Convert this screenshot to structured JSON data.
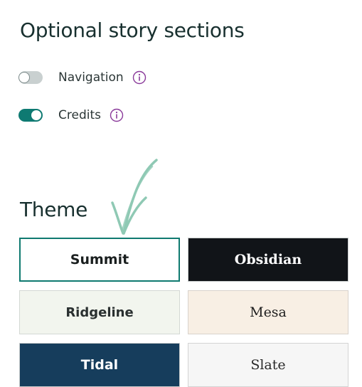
{
  "optional_sections": {
    "title": "Optional story sections",
    "toggles": [
      {
        "label": "Navigation",
        "enabled": false,
        "info_icon": "info-icon"
      },
      {
        "label": "Credits",
        "enabled": true,
        "info_icon": "info-icon"
      }
    ]
  },
  "theme": {
    "title": "Theme",
    "selected": "Summit",
    "options": [
      {
        "label": "Summit",
        "background": "#ffffff",
        "text_color": "#1a1f1f"
      },
      {
        "label": "Obsidian",
        "background": "#111418",
        "text_color": "#ffffff"
      },
      {
        "label": "Ridgeline",
        "background": "#f2f5ee",
        "text_color": "#2a3030"
      },
      {
        "label": "Mesa",
        "background": "#f8efe4",
        "text_color": "#1e1e1e"
      },
      {
        "label": "Tidal",
        "background": "#163d5c",
        "text_color": "#ffffff"
      },
      {
        "label": "Slate",
        "background": "#f6f6f6",
        "text_color": "#2a2a2a"
      }
    ]
  },
  "colors": {
    "accent": "#0e7a72",
    "info_icon": "#8a3a9a",
    "annotation_arrow": "#8fc9b4"
  }
}
